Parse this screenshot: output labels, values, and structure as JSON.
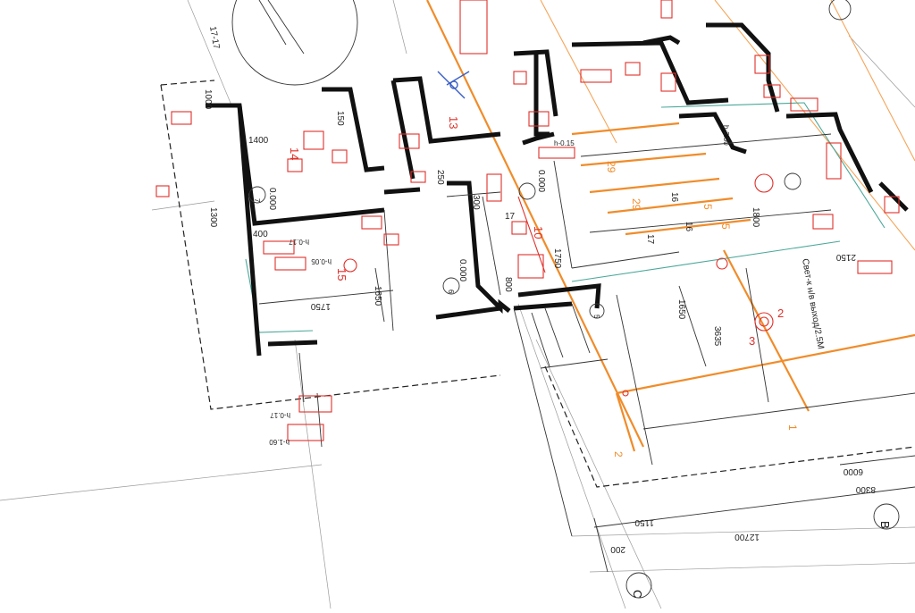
{
  "image": {
    "description_tag": "architectural-floor-plan-blueprint",
    "colors": {
      "walls": "#111111",
      "accent_orange": "#f08c2a",
      "markup_red": "#e0302a",
      "teal_line": "#4aa89a",
      "background": "#ffffff"
    }
  },
  "labels": {
    "section_mark": "17-17",
    "axis_c": "C",
    "axis_b": "B",
    "axis_5": "5",
    "room_7": "7",
    "room_6": "6",
    "level_7": "0.000",
    "level_6": "0.000",
    "level_5": "0.000",
    "room_num_14": "14",
    "room_num_15": "15",
    "room_num_13": "13",
    "room_num_10": "10",
    "room_num_17": "17",
    "room_num_16a": "16",
    "room_num_16b": "16",
    "fixture_2": "2",
    "fixture_3": "3",
    "fixture_1": "1",
    "fixture_2b": "2",
    "ann_vert": "Свет-к н/в выход/2.5М",
    "h_017a": "h-0.17",
    "h_017b": "h-0.17",
    "h_160": "h-1.60",
    "h_005": "h-0.05",
    "h_015": "h-0.15",
    "h_250": "h-2.50"
  },
  "dimensions": {
    "d1400": "1400",
    "d1300": "1300",
    "d400": "400",
    "d1750": "1750",
    "d1650a": "1650",
    "d1650b": "1650",
    "d1750b": "1750",
    "d800": "800",
    "d300": "300",
    "d1800": "1800",
    "d150": "150",
    "d250": "250",
    "d1150": "1150",
    "d12700": "12700",
    "d6000": "6000",
    "d8300": "8300",
    "d200": "200",
    "d2150": "2150",
    "d3635": "3635",
    "d29a": "29",
    "d29b": "29",
    "d5a": "5",
    "d5b": "5",
    "d17": "17",
    "d1000": "1000"
  }
}
